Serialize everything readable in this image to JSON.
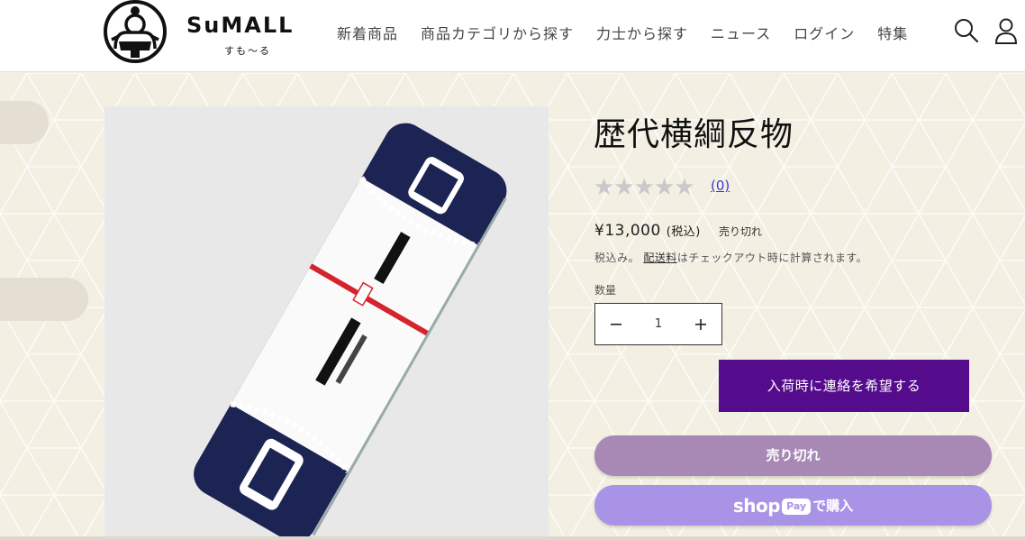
{
  "header": {
    "logo_text": "SuMALL",
    "logo_sub": "すも〜る",
    "nav": [
      "新着商品",
      "商品カテゴリから探す",
      "力士から探す",
      "ニュース",
      "ログイン",
      "特集"
    ]
  },
  "product": {
    "title": "歴代横綱反物",
    "rating_count": "(0)",
    "price": "¥13,000",
    "price_tax": "(税込)",
    "sold_out_badge": "売り切れ",
    "tax_note_prefix": "税込み。",
    "tax_note_link": "配送料",
    "tax_note_suffix": "はチェックアウト時に計算されます。",
    "quantity_label": "数量",
    "quantity_value": "1",
    "notify_button": "入荷時に連絡を希望する",
    "soldout_button": "売り切れ",
    "shoppay_shop": "shop",
    "shoppay_pay": "Pay",
    "shoppay_buy": "で購入"
  },
  "colors": {
    "notify_bg": "#540b8c",
    "soldout_bg": "#a889b5",
    "shoppay_bg": "#a993e6",
    "page_bg": "#f3efe2"
  },
  "icons": [
    "search-icon",
    "account-icon",
    "minus-icon",
    "plus-icon",
    "star-icon"
  ]
}
